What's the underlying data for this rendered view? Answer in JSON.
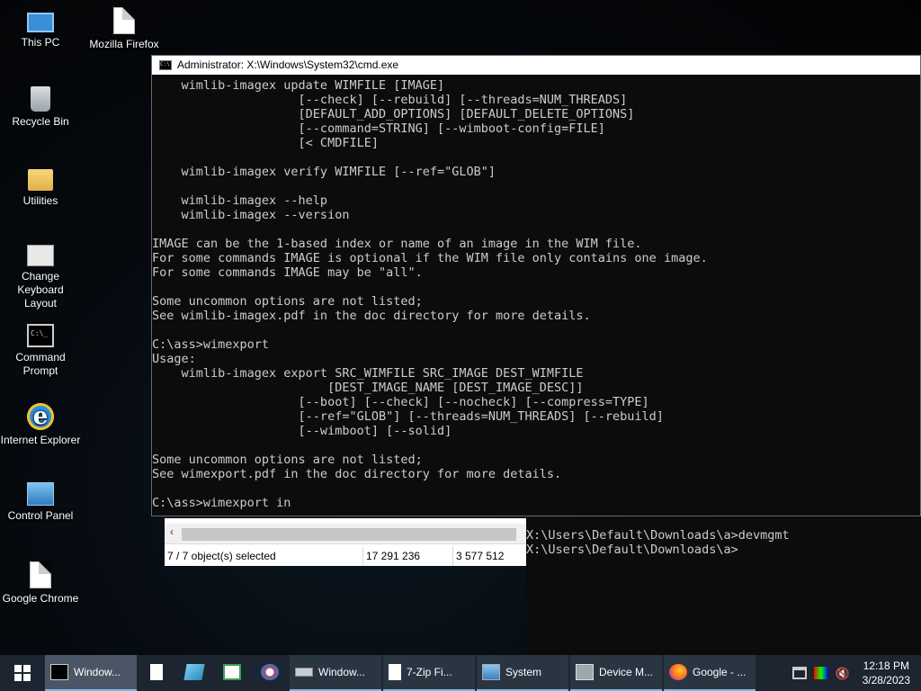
{
  "desktop": {
    "icons": [
      {
        "label": "This PC",
        "icon": "this-pc-icon"
      },
      {
        "label": "Mozilla Firefox",
        "icon": "document-icon"
      },
      {
        "label": "Recycle Bin",
        "icon": "recycle-bin-icon"
      },
      {
        "label": "Utilities",
        "icon": "folder-icon"
      },
      {
        "label": "Change Keyboard Layout",
        "icon": "keyboard-settings-icon"
      },
      {
        "label": "Command Prompt",
        "icon": "command-prompt-icon"
      },
      {
        "label": "Internet Explorer",
        "icon": "internet-explorer-icon"
      },
      {
        "label": "Control Panel",
        "icon": "control-panel-icon"
      },
      {
        "label": "Google Chrome",
        "icon": "document-icon"
      }
    ]
  },
  "cmd_window": {
    "title": "Administrator: X:\\Windows\\System32\\cmd.exe",
    "lines": [
      "    wimlib-imagex update WIMFILE [IMAGE]",
      "                    [--check] [--rebuild] [--threads=NUM_THREADS]",
      "                    [DEFAULT_ADD_OPTIONS] [DEFAULT_DELETE_OPTIONS]",
      "                    [--command=STRING] [--wimboot-config=FILE]",
      "                    [< CMDFILE]",
      "",
      "    wimlib-imagex verify WIMFILE [--ref=\"GLOB\"]",
      "",
      "    wimlib-imagex --help",
      "    wimlib-imagex --version",
      "",
      "IMAGE can be the 1-based index or name of an image in the WIM file.",
      "For some commands IMAGE is optional if the WIM file only contains one image.",
      "For some commands IMAGE may be \"all\".",
      "",
      "Some uncommon options are not listed;",
      "See wimlib-imagex.pdf in the doc directory for more details.",
      "",
      "C:\\ass>wimexport",
      "Usage:",
      "    wimlib-imagex export SRC_WIMFILE SRC_IMAGE DEST_WIMFILE",
      "                        [DEST_IMAGE_NAME [DEST_IMAGE_DESC]]",
      "                    [--boot] [--check] [--nocheck] [--compress=TYPE]",
      "                    [--ref=\"GLOB\"] [--threads=NUM_THREADS] [--rebuild]",
      "                    [--wimboot] [--solid]",
      "",
      "Some uncommon options are not listed;",
      "See wimexport.pdf in the doc directory for more details.",
      "",
      "C:\\ass>wimexport in"
    ]
  },
  "background_cmd": {
    "lines": [
      "X:\\Users\\Default\\Downloads\\a>devmgmt",
      "",
      "X:\\Users\\Default\\Downloads\\a>"
    ]
  },
  "zip_window": {
    "status": {
      "selected": "7 / 7 object(s) selected",
      "size": "17 291 236",
      "packed": "3 577 512"
    }
  },
  "taskbar": {
    "buttons": [
      {
        "label": "Window...",
        "icon": "cmd-icon",
        "kind": "wide",
        "active": true
      },
      {
        "label": "",
        "icon": "document-icon",
        "kind": "small"
      },
      {
        "label": "",
        "icon": "book-icon",
        "kind": "small"
      },
      {
        "label": "",
        "icon": "notepad-icon",
        "kind": "small"
      },
      {
        "label": "",
        "icon": "paint-icon",
        "kind": "small"
      },
      {
        "label": "Window...",
        "icon": "drive-icon",
        "kind": "wide",
        "active": false
      },
      {
        "label": "7-Zip Fi...",
        "icon": "document-icon",
        "kind": "wide",
        "active": false
      },
      {
        "label": "System",
        "icon": "system-icon",
        "kind": "wide",
        "active": false
      },
      {
        "label": "Device M...",
        "icon": "device-manager-icon",
        "kind": "wide",
        "active": false
      },
      {
        "label": "Google - ...",
        "icon": "firefox-icon",
        "kind": "wide",
        "active": false
      }
    ],
    "clock": {
      "time": "12:18 PM",
      "date": "3/28/2023"
    }
  }
}
